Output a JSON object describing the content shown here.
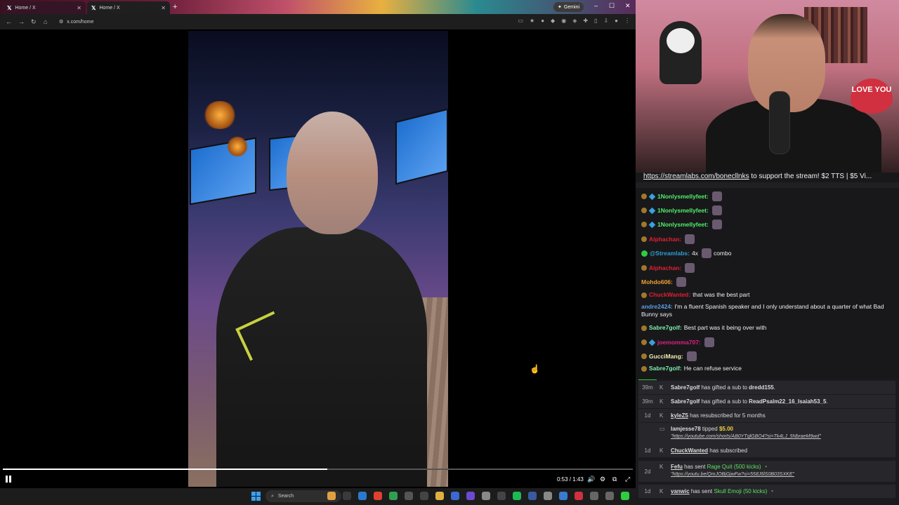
{
  "browser": {
    "tabs": [
      {
        "title": "Home / X"
      },
      {
        "title": "Home / X"
      }
    ],
    "new_tab_label": "+",
    "gemini_label": "Gemini",
    "window_controls": {
      "minimize": "–",
      "maximize": "☐",
      "close": "✕"
    },
    "url": "x.com/home"
  },
  "video": {
    "timecode": "0:53 / 1:43",
    "progress_fraction": 0.515
  },
  "webcam": {
    "sign_text": "LOVE YOU"
  },
  "chat": {
    "banner_link": "https://streamlabs.com/bonecllnks",
    "banner_text": " to support the stream! $2 TTS | $5 Vi...",
    "messages": [
      {
        "user": "1Nonlysmellyfeet:",
        "text": "",
        "user_color": "#4ff06a",
        "badges": [
          "bits",
          "sub"
        ],
        "emote": true
      },
      {
        "user": "1Nonlysmellyfeet:",
        "text": "",
        "user_color": "#4ff06a",
        "badges": [
          "bits",
          "sub"
        ],
        "emote": true
      },
      {
        "user": "1Nonlysmellyfeet:",
        "text": "",
        "user_color": "#4ff06a",
        "badges": [
          "bits",
          "sub"
        ],
        "emote": true
      },
      {
        "user": "Alphachan:",
        "text": "",
        "user_color": "#e02030",
        "badges": [
          "bits"
        ],
        "emote": true
      },
      {
        "user": "@Streamlabs:",
        "text": "4x",
        "text2": "combo",
        "user_color": "#2e9fd0",
        "badges": [
          "verified"
        ],
        "emote": true
      },
      {
        "user": "Alphachan:",
        "text": "",
        "user_color": "#e02030",
        "badges": [
          "bits"
        ],
        "emote": true
      },
      {
        "user": "Mohdo606:",
        "text": "",
        "user_color": "#f0a030",
        "badges": [],
        "emote": true
      },
      {
        "user": "ChuckWanted:",
        "text": "that was the best part",
        "user_color": "#e02030",
        "badges": [
          "bits"
        ],
        "emote": false
      },
      {
        "user": "andre2424:",
        "text": "I'm a fluent Spanish speaker and I only understand about a quarter of what Bad Bunny says",
        "user_color": "#5a9fe0",
        "badges": [],
        "emote": false
      },
      {
        "user": "Sabre7golf:",
        "text": "Best part was it being over with",
        "user_color": "#7ff0b0",
        "badges": [
          "bits"
        ],
        "emote": false
      },
      {
        "user": "joemomma707:",
        "text": "",
        "user_color": "#e02080",
        "badges": [
          "bits",
          "sub"
        ],
        "emote": true
      },
      {
        "user": "GucciMang:",
        "text": "",
        "user_color": "#f0f0b0",
        "badges": [
          "bits"
        ],
        "emote": true
      },
      {
        "user": "Sabre7golf:",
        "text": "He can refuse service",
        "user_color": "#7ff0b0",
        "badges": [
          "bits"
        ],
        "emote": false
      }
    ]
  },
  "events": [
    {
      "age": "39m",
      "user": "Sabre7golf",
      "mid": " has gifted a sub to ",
      "target": "dredd155",
      "end": "."
    },
    {
      "age": "39m",
      "user": "Sabre7golf",
      "mid": " has gifted a sub to ",
      "target": "ReadPsalm22_16_Isaiah53_5",
      "end": "."
    },
    {
      "age": "1d",
      "user": "kyleZ5",
      "mid": " has resubscribed for 5 months",
      "target": "",
      "end": ""
    },
    {
      "age": "",
      "user": "Iamjesse78",
      "mid": " tipped ",
      "amount": "$5.00",
      "link": "\"https://youtube.com/shorts/AB0YTqlGBO4?si=Tk4LJ_5NbraeM9wd\""
    },
    {
      "age": "1d",
      "user": "ChuckWanted",
      "mid": " has subscribed",
      "target": "",
      "end": ""
    },
    {
      "age": "2d",
      "user": "Fefu",
      "mid": " has sent ",
      "gift": "Rage Quit (500 kicks)",
      "link": "\"https://youtu.be/QmJOBjGjwFw?si=558J6lS0B03SXKE\""
    },
    {
      "age": "1d",
      "user": "vanwic",
      "mid": " has sent ",
      "gift": "Skull Emoji (50 kicks)"
    }
  ],
  "taskbar": {
    "search_placeholder": "Search"
  },
  "colors": {
    "accent_green": "#2ecc40",
    "chat_bg": "#18181b",
    "windows_blue": "#3a9ff5"
  }
}
